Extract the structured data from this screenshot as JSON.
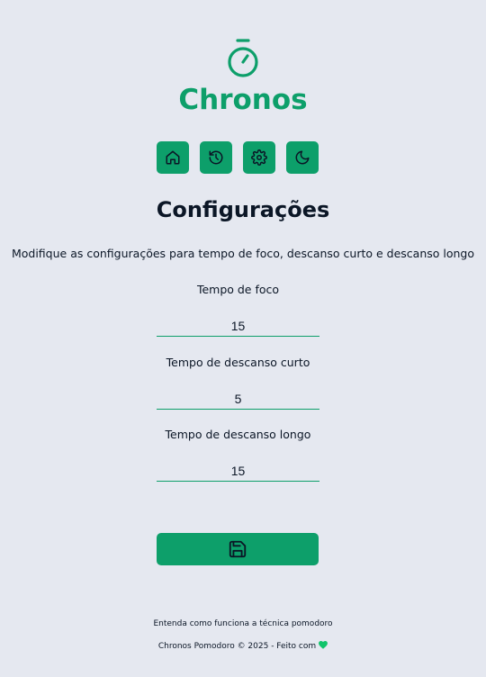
{
  "app": {
    "name": "Chronos",
    "logo_icon": "stopwatch-icon",
    "accent_color": "#0d9f6a",
    "background_color": "#e5e8f0"
  },
  "nav": {
    "items": [
      {
        "icon": "home-icon"
      },
      {
        "icon": "history-icon"
      },
      {
        "icon": "settings-gear-icon"
      },
      {
        "icon": "moon-icon"
      }
    ]
  },
  "page": {
    "title": "Configurações",
    "description": "Modifique as configurações para tempo de foco, descanso curto e descanso longo"
  },
  "form": {
    "focus": {
      "label": "Tempo de foco",
      "value": "15"
    },
    "short_break": {
      "label": "Tempo de descanso curto",
      "value": "5"
    },
    "long_break": {
      "label": "Tempo de descanso longo",
      "value": "15"
    },
    "save_icon": "save-floppy-icon"
  },
  "footer": {
    "link_text": "Entenda como funciona a técnica pomodoro",
    "copyright_text": "Chronos Pomodoro © 2025 - Feito com",
    "heart_icon": "heart-icon",
    "heart_color": "#10c46a"
  }
}
